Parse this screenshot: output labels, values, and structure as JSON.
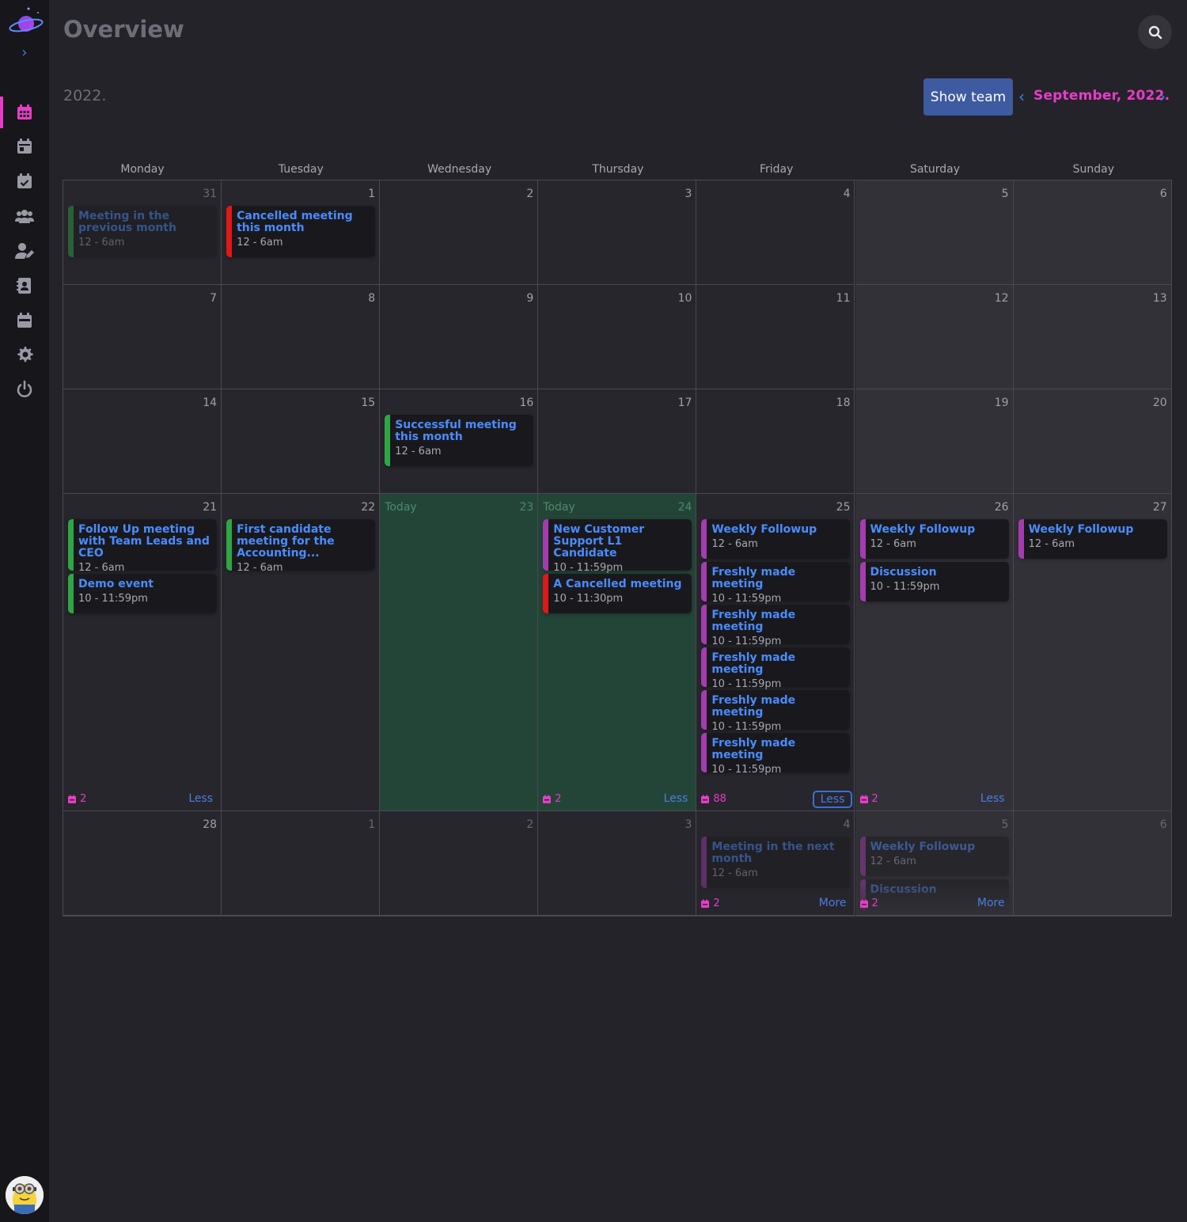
{
  "header": {
    "title": "Overview",
    "year": "2022.",
    "show_team": "Show team",
    "month": "September, 2022."
  },
  "colors": {
    "accent": "#e83cc8",
    "link": "#4a8cff",
    "today": "#234537",
    "green": "#2ea644",
    "red": "#e01818",
    "purple": "#a43cb0"
  },
  "sidebar": {
    "items": [
      {
        "icon": "calendar-grid-icon",
        "active": true
      },
      {
        "icon": "calendar-day-icon"
      },
      {
        "icon": "calendar-check-icon"
      },
      {
        "icon": "users-icon"
      },
      {
        "icon": "user-edit-icon"
      },
      {
        "icon": "contact-card-icon"
      },
      {
        "icon": "calendar-week-icon"
      },
      {
        "icon": "gear-icon"
      },
      {
        "icon": "power-icon"
      }
    ]
  },
  "weekdays": [
    "Monday",
    "Tuesday",
    "Wednesday",
    "Thursday",
    "Friday",
    "Saturday",
    "Sunday"
  ],
  "today_label": "Today",
  "weeks": [
    [
      {
        "day": "31",
        "other": true,
        "events": [
          {
            "title": "Meeting in the previous month",
            "time": "12 - 6am",
            "color": "green",
            "faded": true
          }
        ]
      },
      {
        "day": "1",
        "events": [
          {
            "title": "Cancelled meeting this month",
            "time": "12 - 6am",
            "color": "red"
          }
        ]
      },
      {
        "day": "2",
        "events": []
      },
      {
        "day": "3",
        "events": []
      },
      {
        "day": "4",
        "events": []
      },
      {
        "day": "5",
        "events": []
      },
      {
        "day": "6",
        "events": []
      }
    ],
    [
      {
        "day": "7",
        "events": []
      },
      {
        "day": "8",
        "events": []
      },
      {
        "day": "9",
        "events": []
      },
      {
        "day": "10",
        "events": []
      },
      {
        "day": "11",
        "events": []
      },
      {
        "day": "12",
        "events": []
      },
      {
        "day": "13",
        "events": []
      }
    ],
    [
      {
        "day": "14",
        "events": []
      },
      {
        "day": "15",
        "events": []
      },
      {
        "day": "16",
        "events": [
          {
            "title": "Successful meeting this month",
            "time": "12 - 6am",
            "color": "green"
          }
        ]
      },
      {
        "day": "17",
        "events": []
      },
      {
        "day": "18",
        "events": []
      },
      {
        "day": "19",
        "events": []
      },
      {
        "day": "20",
        "events": []
      }
    ],
    [
      {
        "day": "21",
        "events": [
          {
            "title": "Follow Up meeting with Team Leads and CEO",
            "time": "12 - 6am",
            "color": "green"
          },
          {
            "title": "Demo event",
            "time": "10 - 11:59pm",
            "color": "green"
          }
        ],
        "count": "2",
        "toggle": "Less"
      },
      {
        "day": "22",
        "events": [
          {
            "title": "First candidate meeting for the Accounting...",
            "time": "12 - 6am",
            "color": "green"
          }
        ]
      },
      {
        "day": "23",
        "today": true,
        "events": []
      },
      {
        "day": "24",
        "today": true,
        "events": [
          {
            "title": "New Customer Support L1 Candidate",
            "time": "10 - 11:59pm",
            "color": "purple"
          },
          {
            "title": "A Cancelled meeting",
            "time": "10 - 11:30pm",
            "color": "red"
          }
        ],
        "count": "2",
        "toggle": "Less"
      },
      {
        "day": "25",
        "events": [
          {
            "title": "Weekly Followup",
            "time": "12 - 6am",
            "color": "purple"
          },
          {
            "title": "Freshly made meeting",
            "time": "10 - 11:59pm",
            "color": "purple"
          },
          {
            "title": "Freshly made meeting",
            "time": "10 - 11:59pm",
            "color": "purple"
          },
          {
            "title": "Freshly made meeting",
            "time": "10 - 11:59pm",
            "color": "purple"
          },
          {
            "title": "Freshly made meeting",
            "time": "10 - 11:59pm",
            "color": "purple"
          },
          {
            "title": "Freshly made meeting",
            "time": "10 - 11:59pm",
            "color": "purple"
          }
        ],
        "count": "88",
        "toggle": "Less",
        "boxed": true
      },
      {
        "day": "26",
        "events": [
          {
            "title": "Weekly Followup",
            "time": "12 - 6am",
            "color": "purple"
          },
          {
            "title": "Discussion",
            "time": "10 - 11:59pm",
            "color": "purple"
          }
        ],
        "count": "2",
        "toggle": "Less"
      },
      {
        "day": "27",
        "events": [
          {
            "title": "Weekly Followup",
            "time": "12 - 6am",
            "color": "purple"
          }
        ]
      }
    ],
    [
      {
        "day": "28",
        "events": []
      },
      {
        "day": "1",
        "other": true,
        "events": []
      },
      {
        "day": "2",
        "other": true,
        "events": []
      },
      {
        "day": "3",
        "other": true,
        "events": []
      },
      {
        "day": "4",
        "other": true,
        "events": [
          {
            "title": "Meeting in the next month",
            "time": "12 - 6am",
            "color": "purple",
            "faded": true
          }
        ],
        "count": "2",
        "toggle": "More",
        "overflow": true
      },
      {
        "day": "5",
        "other": true,
        "events": [
          {
            "title": "Weekly Followup",
            "time": "12 - 6am",
            "color": "purple",
            "faded": true
          },
          {
            "title": "Discussion",
            "time": "",
            "color": "purple",
            "faded": true
          }
        ],
        "count": "2",
        "toggle": "More",
        "overflow": true
      },
      {
        "day": "6",
        "other": true,
        "events": []
      }
    ]
  ]
}
